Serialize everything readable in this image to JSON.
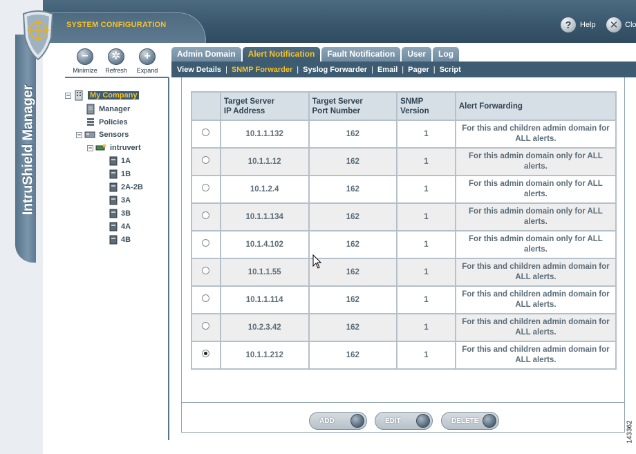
{
  "header": {
    "app_title": "SYSTEM CONFIGURATION",
    "help_label": "Help",
    "close_label": "Clo",
    "product_name": "IntruShield Manager"
  },
  "toolbar": {
    "minimize_label": "Minimize",
    "refresh_label": "Refresh",
    "expand_label": "Expand"
  },
  "tree": {
    "root": "My Company",
    "manager": "Manager",
    "policies": "Policies",
    "sensors": "Sensors",
    "sensor_name": "intruvert",
    "ports": [
      "1A",
      "1B",
      "2A-2B",
      "3A",
      "3B",
      "4A",
      "4B"
    ]
  },
  "tabs": [
    {
      "label": "Admin Domain",
      "active": false
    },
    {
      "label": "Alert Notification",
      "active": true
    },
    {
      "label": "Fault Notification",
      "active": false
    },
    {
      "label": "User",
      "active": false
    },
    {
      "label": "Log",
      "active": false
    }
  ],
  "subnav": [
    {
      "label": "View Details",
      "active": false
    },
    {
      "label": "SNMP Forwarder",
      "active": true
    },
    {
      "label": "Syslog Forwarder",
      "active": false
    },
    {
      "label": "Email",
      "active": false
    },
    {
      "label": "Pager",
      "active": false
    },
    {
      "label": "Script",
      "active": false
    }
  ],
  "table": {
    "headers": {
      "ip_line1": "Target Server",
      "ip_line2": "IP Address",
      "port_line1": "Target Server",
      "port_line2": "Port Number",
      "ver_line1": "SNMP",
      "ver_line2": "Version",
      "forwarding": "Alert Forwarding"
    },
    "rows": [
      {
        "ip": "10.1.1.132",
        "port": "162",
        "version": "1",
        "forwarding": "For this and children admin domain for ALL alerts.",
        "selected": false
      },
      {
        "ip": "10.1.1.12",
        "port": "162",
        "version": "1",
        "forwarding": "For this admin domain only for ALL alerts.",
        "selected": false
      },
      {
        "ip": "10.1.2.4",
        "port": "162",
        "version": "1",
        "forwarding": "For this admin domain only for ALL alerts.",
        "selected": false
      },
      {
        "ip": "10.1.1.134",
        "port": "162",
        "version": "1",
        "forwarding": "For this admin domain only for ALL alerts.",
        "selected": false
      },
      {
        "ip": "10.1.4.102",
        "port": "162",
        "version": "1",
        "forwarding": "For this admin domain only for ALL alerts.",
        "selected": false
      },
      {
        "ip": "10.1.1.55",
        "port": "162",
        "version": "1",
        "forwarding": "For this and children admin domain for ALL alerts.",
        "selected": false
      },
      {
        "ip": "10.1.1.114",
        "port": "162",
        "version": "1",
        "forwarding": "For this and children admin domain for ALL alerts.",
        "selected": false
      },
      {
        "ip": "10.2.3.42",
        "port": "162",
        "version": "1",
        "forwarding": "For this and children admin domain for ALL alerts.",
        "selected": false
      },
      {
        "ip": "10.1.1.212",
        "port": "162",
        "version": "1",
        "forwarding": "For this and children admin domain for ALL alerts.",
        "selected": true
      }
    ]
  },
  "actions": {
    "add_label": "ADD",
    "edit_label": "EDIT",
    "delete_label": "DELETE"
  },
  "figure_number": "143362",
  "colors": {
    "accent_yellow": "#f7c22b",
    "nav_blue": "#3d5b71",
    "header_blue": "#39576d"
  }
}
